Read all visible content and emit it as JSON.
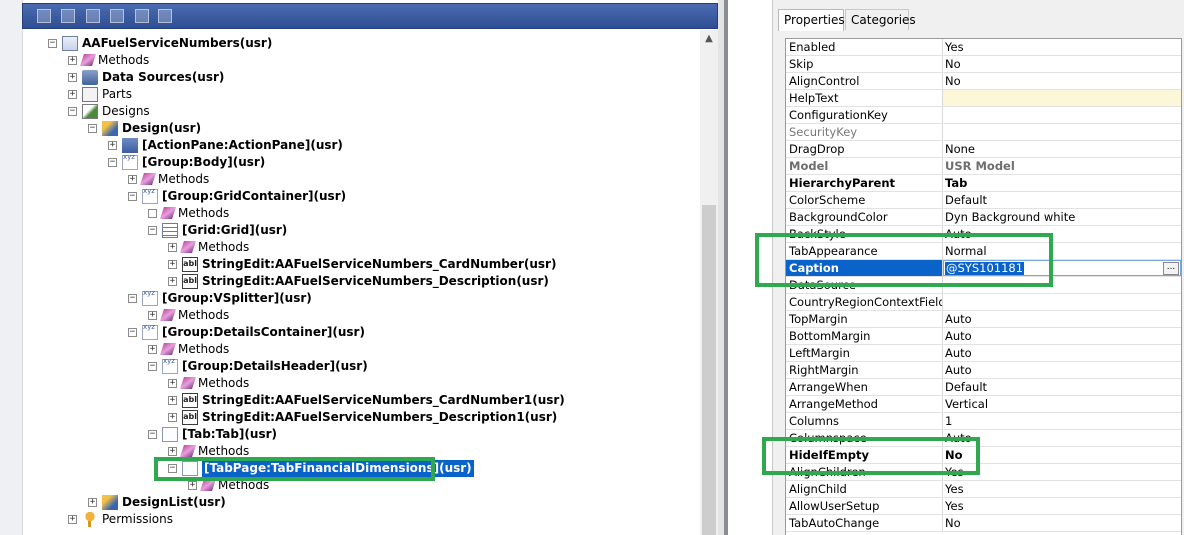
{
  "toolbar": {
    "icons": [
      "open-icon",
      "properties-icon",
      "save-icon",
      "sort-icon",
      "filter-icon",
      "compile-icon"
    ]
  },
  "tree": {
    "nodes": [
      {
        "label": "AAFuelServiceNumbers(usr)",
        "icon": "form-icon",
        "expander": "−"
      },
      {
        "label": "Methods",
        "icon": "methods-icon",
        "expander": "+"
      },
      {
        "label": "Data Sources(usr)",
        "icon": "data-sources-icon",
        "expander": "+"
      },
      {
        "label": "Parts",
        "icon": "parts-icon",
        "expander": "+"
      },
      {
        "label": "Designs",
        "icon": "designs-icon",
        "expander": "−"
      },
      {
        "label": "Design(usr)",
        "icon": "design-icon",
        "expander": "−"
      },
      {
        "label": "[ActionPane:ActionPane](usr)",
        "icon": "action-pane-icon",
        "expander": "+"
      },
      {
        "label": "[Group:Body](usr)",
        "icon": "group-icon",
        "expander": "−"
      },
      {
        "label": "Methods",
        "icon": "methods-icon",
        "expander": "+"
      },
      {
        "label": "[Group:GridContainer](usr)",
        "icon": "group-icon",
        "expander": "−"
      },
      {
        "label": "Methods",
        "icon": "methods-icon",
        "expander": ""
      },
      {
        "label": "[Grid:Grid](usr)",
        "icon": "grid-icon",
        "expander": "−"
      },
      {
        "label": "Methods",
        "icon": "methods-icon",
        "expander": "+"
      },
      {
        "label": "StringEdit:AAFuelServiceNumbers_CardNumber(usr)",
        "icon": "string-edit-icon",
        "expander": "+"
      },
      {
        "label": "StringEdit:AAFuelServiceNumbers_Description(usr)",
        "icon": "string-edit-icon",
        "expander": "+"
      },
      {
        "label": "[Group:VSplitter](usr)",
        "icon": "group-icon",
        "expander": "−"
      },
      {
        "label": "Methods",
        "icon": "methods-icon",
        "expander": "+"
      },
      {
        "label": "[Group:DetailsContainer](usr)",
        "icon": "group-icon",
        "expander": "−"
      },
      {
        "label": "Methods",
        "icon": "methods-icon",
        "expander": "+"
      },
      {
        "label": "[Group:DetailsHeader](usr)",
        "icon": "group-icon",
        "expander": "−"
      },
      {
        "label": "Methods",
        "icon": "methods-icon",
        "expander": "+"
      },
      {
        "label": "StringEdit:AAFuelServiceNumbers_CardNumber1(usr)",
        "icon": "string-edit-icon",
        "expander": "+"
      },
      {
        "label": "StringEdit:AAFuelServiceNumbers_Description1(usr)",
        "icon": "string-edit-icon",
        "expander": "+"
      },
      {
        "label": "[Tab:Tab](usr)",
        "icon": "tab-icon",
        "expander": "−"
      },
      {
        "label": "Methods",
        "icon": "methods-icon",
        "expander": "+"
      },
      {
        "label": "[TabPage:TabFinancialDimensions](usr)",
        "icon": "tab-page-icon",
        "expander": "−"
      },
      {
        "label": "Methods",
        "icon": "methods-icon",
        "expander": "+"
      },
      {
        "label": "DesignList(usr)",
        "icon": "design-icon",
        "expander": "+"
      },
      {
        "label": "Permissions",
        "icon": "key-icon",
        "expander": "+"
      }
    ],
    "string_edit_icon_text": "abl"
  },
  "properties": {
    "tabs": [
      "Properties",
      "Categories"
    ],
    "rows": [
      {
        "name": "Enabled",
        "value": "Yes",
        "style": ""
      },
      {
        "name": "Skip",
        "value": "No",
        "style": ""
      },
      {
        "name": "AlignControl",
        "value": "No",
        "style": ""
      },
      {
        "name": "HelpText",
        "value": "",
        "style": "yellow"
      },
      {
        "name": "ConfigurationKey",
        "value": "",
        "style": ""
      },
      {
        "name": "SecurityKey",
        "value": "",
        "style": "grey"
      },
      {
        "name": "DragDrop",
        "value": "None",
        "style": ""
      },
      {
        "name": "Model",
        "value": "USR Model",
        "style": "greybold"
      },
      {
        "name": "HierarchyParent",
        "value": "Tab",
        "style": "boldrow"
      },
      {
        "name": "ColorScheme",
        "value": "Default",
        "style": ""
      },
      {
        "name": "BackgroundColor",
        "value": "Dyn Background white",
        "style": ""
      },
      {
        "name": "BackStyle",
        "value": "Auto",
        "style": ""
      },
      {
        "name": "TabAppearance",
        "value": "Normal",
        "style": ""
      },
      {
        "name": "Caption",
        "value": "@SYS101181",
        "style": "selrow"
      },
      {
        "name": "DataSource",
        "value": "",
        "style": ""
      },
      {
        "name": "CountryRegionContextField",
        "value": "",
        "style": ""
      },
      {
        "name": "TopMargin",
        "value": "Auto",
        "style": ""
      },
      {
        "name": "BottomMargin",
        "value": "Auto",
        "style": ""
      },
      {
        "name": "LeftMargin",
        "value": "Auto",
        "style": ""
      },
      {
        "name": "RightMargin",
        "value": "Auto",
        "style": ""
      },
      {
        "name": "ArrangeWhen",
        "value": "Default",
        "style": ""
      },
      {
        "name": "ArrangeMethod",
        "value": "Vertical",
        "style": ""
      },
      {
        "name": "Columns",
        "value": "1",
        "style": ""
      },
      {
        "name": "Columnspace",
        "value": "Auto",
        "style": ""
      },
      {
        "name": "HideIfEmpty",
        "value": "No",
        "style": "boldrow"
      },
      {
        "name": "AlignChildren",
        "value": "Yes",
        "style": ""
      },
      {
        "name": "AlignChild",
        "value": "Yes",
        "style": ""
      },
      {
        "name": "AllowUserSetup",
        "value": "Yes",
        "style": ""
      },
      {
        "name": "TabAutoChange",
        "value": "No",
        "style": ""
      }
    ],
    "ellipsis_label": "..."
  },
  "colors": {
    "highlight_green": "#2fa84f",
    "selection_blue": "#0a63c9",
    "toolbar_blue": "#3a5ba0"
  }
}
